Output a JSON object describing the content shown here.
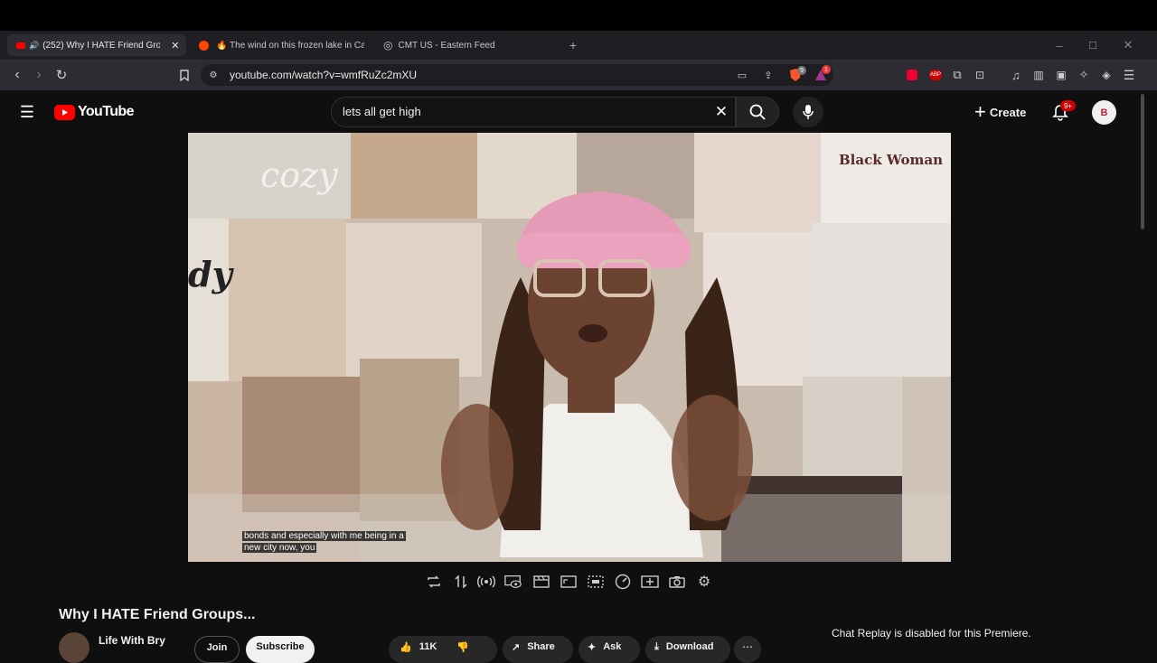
{
  "browser": {
    "tabs": [
      {
        "title": "(252) Why I HATE Friend Grou",
        "active": true
      },
      {
        "title": "🔥 The wind on this frozen lake in Ca",
        "active": false
      },
      {
        "title": "CMT US - Eastern Feed",
        "active": false
      }
    ],
    "url": "youtube.com/watch?v=wmfRuZc2mXU",
    "brave_shield_count": "9",
    "rewards_count": "1"
  },
  "youtube": {
    "logo_text": "YouTube",
    "search_query": "lets all get high",
    "create_label": "Create",
    "notification_badge": "9+",
    "avatar_text": "B"
  },
  "video": {
    "caption_line1": "bonds and especially with me being in a",
    "caption_line2": "new city now, you",
    "poster_text1": "cozy",
    "poster_text2": "Black Woman",
    "poster_text3": "dy",
    "title": "Why I HATE Friend Groups...",
    "channel": "Life With Bry",
    "join_label": "Join",
    "subscribe_label": "Subscribe",
    "likes": "11K",
    "share_label": "Share",
    "ask_label": "Ask",
    "download_label": "Download"
  },
  "chat": {
    "note": "Chat Replay is disabled for this Premiere."
  },
  "colors": {
    "accent_red": "#ff0000",
    "background": "#0f0f0f"
  }
}
